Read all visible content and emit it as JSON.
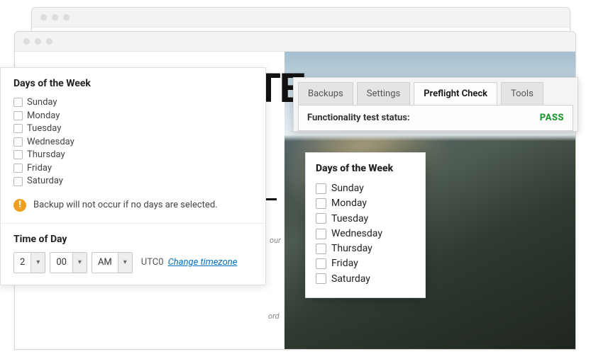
{
  "heading_text": "WEBSITE",
  "tabs": {
    "items": [
      {
        "label": "Backups",
        "active": false
      },
      {
        "label": "Settings",
        "active": false
      },
      {
        "label": "Preflight Check",
        "active": true
      },
      {
        "label": "Tools",
        "active": false
      }
    ],
    "status_label": "Functionality test status:",
    "status_value": "PASS",
    "status_color": "#1a9a2e"
  },
  "days_panel": {
    "title": "Days of the Week",
    "days": [
      "Sunday",
      "Monday",
      "Tuesday",
      "Wednesday",
      "Thursday",
      "Friday",
      "Saturday"
    ],
    "checked": [
      false,
      false,
      false,
      false,
      false,
      false,
      false
    ],
    "warning": "Backup will not occur if no days are selected."
  },
  "time_panel": {
    "title": "Time of Day",
    "hour": "2",
    "minute": "00",
    "ampm": "AM",
    "tz_label": "UTC0",
    "change_tz": "Change timezone"
  },
  "days_float": {
    "title": "Days of the Week",
    "days": [
      "Sunday",
      "Monday",
      "Tuesday",
      "Wednesday",
      "Thursday",
      "Friday",
      "Saturday"
    ]
  },
  "fragments": {
    "our": "our",
    "ord": "ord"
  }
}
